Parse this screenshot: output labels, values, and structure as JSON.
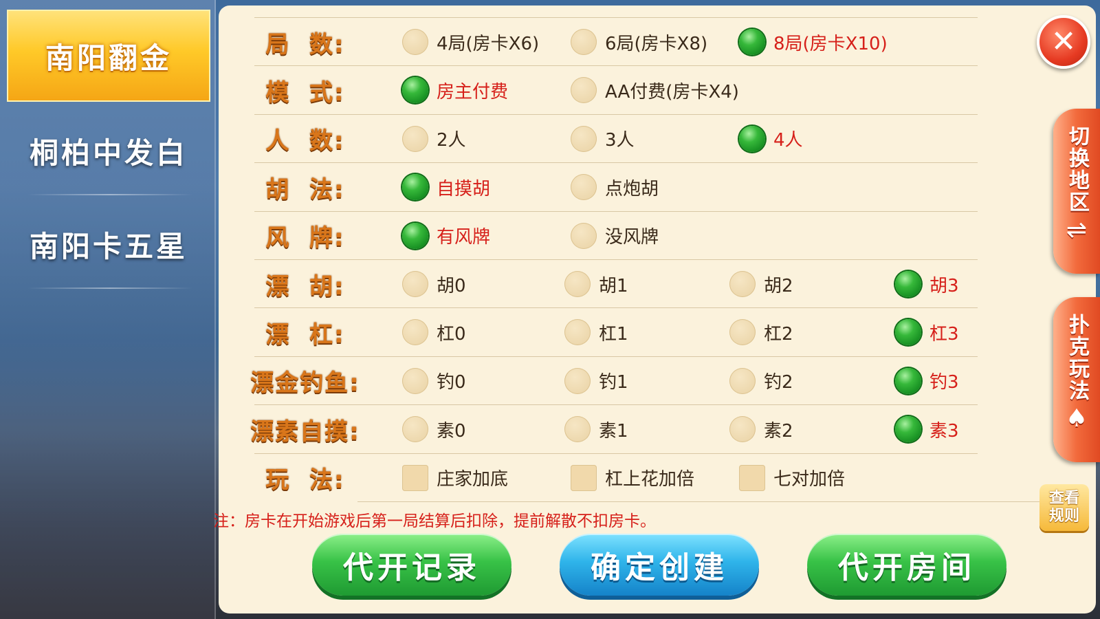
{
  "sidebar": {
    "items": [
      {
        "label": "南阳翻金",
        "active": true
      },
      {
        "label": "桐柏中发白",
        "active": false
      },
      {
        "label": "南阳卡五星",
        "active": false
      }
    ]
  },
  "settings": {
    "rows": [
      {
        "label": "局  数:",
        "type": "radio",
        "options": [
          {
            "text": "4局(房卡X6)",
            "selected": false
          },
          {
            "text": "6局(房卡X8)",
            "selected": false
          },
          {
            "text": "8局(房卡X10)",
            "selected": true
          }
        ]
      },
      {
        "label": "模  式:",
        "type": "radio",
        "options": [
          {
            "text": "房主付费",
            "selected": true
          },
          {
            "text": "AA付费(房卡X4)",
            "selected": false
          }
        ]
      },
      {
        "label": "人  数:",
        "type": "radio",
        "options": [
          {
            "text": "2人",
            "selected": false
          },
          {
            "text": "3人",
            "selected": false
          },
          {
            "text": "4人",
            "selected": true
          }
        ]
      },
      {
        "label": "胡  法:",
        "type": "radio",
        "options": [
          {
            "text": "自摸胡",
            "selected": true
          },
          {
            "text": "点炮胡",
            "selected": false
          }
        ]
      },
      {
        "label": "风  牌:",
        "type": "radio",
        "options": [
          {
            "text": "有风牌",
            "selected": true
          },
          {
            "text": "没风牌",
            "selected": false
          }
        ]
      },
      {
        "label": "漂  胡:",
        "type": "radio",
        "options": [
          {
            "text": "胡0",
            "selected": false
          },
          {
            "text": "胡1",
            "selected": false
          },
          {
            "text": "胡2",
            "selected": false
          },
          {
            "text": "胡3",
            "selected": true
          }
        ]
      },
      {
        "label": "漂  杠:",
        "type": "radio",
        "options": [
          {
            "text": "杠0",
            "selected": false
          },
          {
            "text": "杠1",
            "selected": false
          },
          {
            "text": "杠2",
            "selected": false
          },
          {
            "text": "杠3",
            "selected": true
          }
        ]
      },
      {
        "label": "漂金钓鱼:",
        "type": "radio",
        "options": [
          {
            "text": "钓0",
            "selected": false
          },
          {
            "text": "钓1",
            "selected": false
          },
          {
            "text": "钓2",
            "selected": false
          },
          {
            "text": "钓3",
            "selected": true
          }
        ]
      },
      {
        "label": "漂素自摸:",
        "type": "radio",
        "options": [
          {
            "text": "素0",
            "selected": false
          },
          {
            "text": "素1",
            "selected": false
          },
          {
            "text": "素2",
            "selected": false
          },
          {
            "text": "素3",
            "selected": true
          }
        ]
      },
      {
        "label": "玩  法:",
        "type": "checkbox",
        "options": [
          {
            "text": "庄家加底",
            "selected": false
          },
          {
            "text": "杠上花加倍",
            "selected": false
          },
          {
            "text": "七对加倍",
            "selected": false
          }
        ]
      }
    ],
    "note": "注：房卡在开始游戏后第一局结算后扣除，提前解散不扣房卡。"
  },
  "buttons": {
    "records": "代开记录",
    "create": "确定创建",
    "proxy_room": "代开房间"
  },
  "right_tabs": {
    "switch_region": "切换地区",
    "poker_rules": "扑克玩法",
    "view_rules_line1": "查看",
    "view_rules_line2": "规则"
  },
  "icons": {
    "close": "✕",
    "switch": "⇌",
    "poker": "♠"
  },
  "colors": {
    "accent_gold": "#ffc928",
    "selected_green": "#36b83a",
    "selected_text": "#d6201a",
    "label_orange": "#d9761a",
    "panel_bg": "#fbf2dc"
  }
}
